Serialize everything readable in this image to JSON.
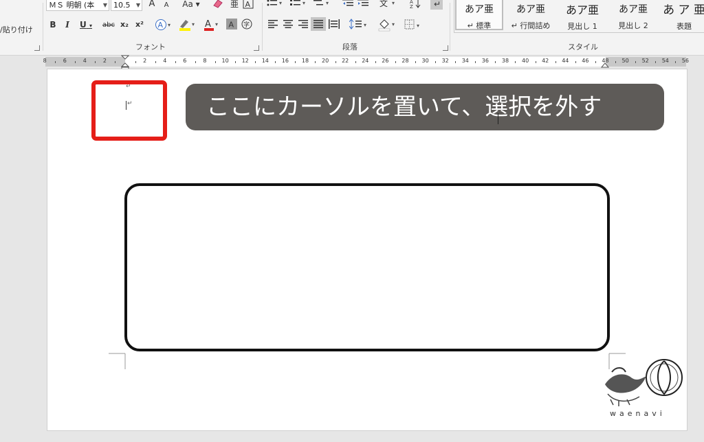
{
  "ribbon": {
    "clipboard": {
      "paste_label": "貼り付け"
    },
    "font": {
      "font_name": "ＭＳ 明朝 (本",
      "font_size": "10.5",
      "case_label": "Aa",
      "bold": "B",
      "italic": "I",
      "underline": "U",
      "strike": "abc",
      "subscript": "x₂",
      "superscript": "x²",
      "grow": "A",
      "shrink": "A",
      "group_title": "フォント"
    },
    "paragraph": {
      "group_title": "段落"
    },
    "styles": {
      "group_title": "スタイル",
      "items": [
        {
          "sample": "あア亜",
          "name": "↵ 標準"
        },
        {
          "sample": "あア亜",
          "name": "↵ 行間詰め"
        },
        {
          "sample": "あア亜",
          "name": "見出し 1"
        },
        {
          "sample": "あア亜",
          "name": "見出し 2"
        },
        {
          "sample": "あ ア 亜",
          "name": "表題"
        }
      ]
    }
  },
  "ruler": {
    "left_numbers": [
      "8",
      "6",
      "4",
      "2"
    ],
    "right_numbers": [
      "2",
      "4",
      "6",
      "8",
      "10",
      "12",
      "14",
      "16",
      "18",
      "20",
      "22",
      "24",
      "26",
      "28",
      "30",
      "32",
      "34",
      "36",
      "38",
      "40",
      "42",
      "44",
      "46",
      "48",
      "50",
      "52",
      "54",
      "56"
    ]
  },
  "document": {
    "paragraph_mark": "↵",
    "callout_text": "ここにカーソルを置いて、選択を外す",
    "highlight_color": "#e51e18",
    "callout_color": "#5e5b58"
  },
  "watermark": {
    "text": "waenavi"
  }
}
